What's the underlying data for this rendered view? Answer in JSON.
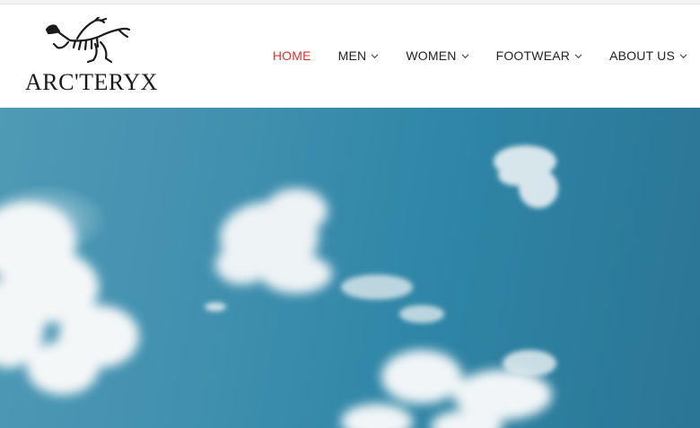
{
  "brand": {
    "name": "ARC'TERYX",
    "logo_icon": "archaeopteryx-icon"
  },
  "nav": {
    "items": [
      {
        "label": "HOME",
        "active": true,
        "has_dropdown": false
      },
      {
        "label": "MEN",
        "active": false,
        "has_dropdown": true
      },
      {
        "label": "WOMEN",
        "active": false,
        "has_dropdown": true
      },
      {
        "label": "FOOTWEAR",
        "active": false,
        "has_dropdown": true
      },
      {
        "label": "ABOUT US",
        "active": false,
        "has_dropdown": true
      }
    ],
    "dropdown_icon": "chevron-down-icon"
  },
  "hero": {
    "image": "sky-with-clouds"
  },
  "colors": {
    "accent": "#e0312a",
    "nav_text": "#222222",
    "sky": "#3f8fae"
  }
}
